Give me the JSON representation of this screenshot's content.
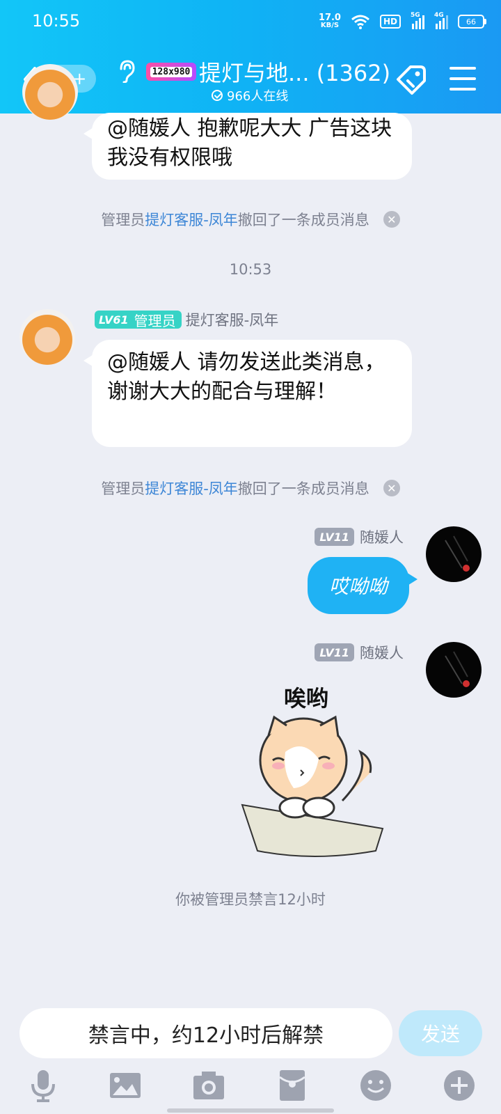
{
  "status_bar": {
    "time": "10:55",
    "net_speed_value": "17.0",
    "net_speed_unit": "KB/S",
    "hd": "HD",
    "sig1": "5G",
    "sig2": "4G",
    "battery": "66"
  },
  "header": {
    "unread_count": "99+",
    "group_badge": "128x980",
    "title": "提灯与地... (1362)",
    "online": "966人在线"
  },
  "messages": {
    "m1_text": "@随媛人 抱歉呢大大 广告这块我没有权限哦",
    "notice1": {
      "prefix": "管理员",
      "name": "提灯客服-凤年",
      "suffix": "撤回了一条成员消息"
    },
    "timestamp": "10:53",
    "m2_level": "LV61",
    "m2_role": "管理员",
    "m2_sender": "提灯客服-凤年",
    "m2_text": "@随媛人 请勿发送此类消息，谢谢大大的配合与理解！",
    "notice2": {
      "prefix": "管理员",
      "name": "提灯客服-凤年",
      "suffix": "撤回了一条成员消息"
    },
    "m3_level": "LV11",
    "m3_sender": "随媛人",
    "m3_text": "哎呦呦",
    "m4_level": "LV11",
    "m4_sender": "随媛人",
    "m4_sticker_text": "唉哟",
    "mute_notice": "你被管理员禁言12小时"
  },
  "input": {
    "status": "禁言中，约12小时后解禁",
    "send_label": "发送"
  },
  "colors": {
    "header_gradient": [
      "#12c6f8",
      "#1a99f3"
    ],
    "accent": "#1fb2f4",
    "link": "#3d86d6",
    "admin_badge": "#36d3c6"
  },
  "icons": [
    "back-icon",
    "ear-icon",
    "tag-icon",
    "menu-icon",
    "mic-icon",
    "image-icon",
    "camera-icon",
    "red-packet-icon",
    "emoji-icon",
    "plus-icon"
  ]
}
